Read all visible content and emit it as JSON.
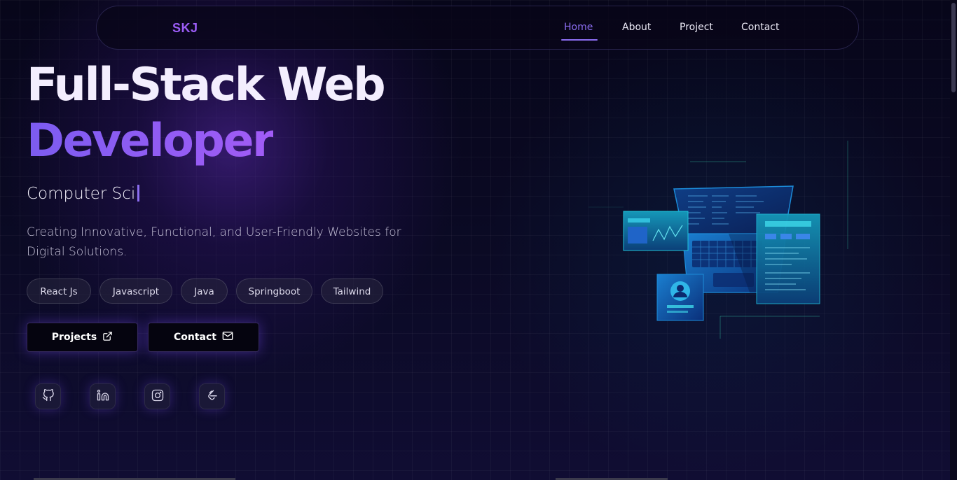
{
  "nav": {
    "logo": "SKJ",
    "links": [
      {
        "label": "Home",
        "active": true
      },
      {
        "label": "About",
        "active": false
      },
      {
        "label": "Project",
        "active": false
      },
      {
        "label": "Contact",
        "active": false
      }
    ]
  },
  "hero": {
    "headline_line1": "Full-Stack Web",
    "headline_line2": "Developer",
    "typing_text": "Computer Sci",
    "tagline": "Creating Innovative, Functional, and User-Friendly Websites for Digital Solutions.",
    "skills": [
      "React Js",
      "Javascript",
      "Java",
      "Springboot",
      "Tailwind"
    ],
    "buttons": {
      "projects": {
        "label": "Projects",
        "icon": "external-link-icon"
      },
      "contact": {
        "label": "Contact",
        "icon": "mail-icon"
      }
    },
    "socials": [
      {
        "name": "github",
        "icon": "github-icon"
      },
      {
        "name": "linkedin",
        "icon": "linkedin-icon"
      },
      {
        "name": "instagram",
        "icon": "instagram-icon"
      },
      {
        "name": "leetcode",
        "icon": "leetcode-icon"
      }
    ]
  },
  "colors": {
    "accent": "#8b6df0",
    "accent_gradient_start": "#7c5cf0",
    "accent_gradient_end": "#a25cf6",
    "background": "#0b0a25",
    "button_bg": "#05040f"
  }
}
